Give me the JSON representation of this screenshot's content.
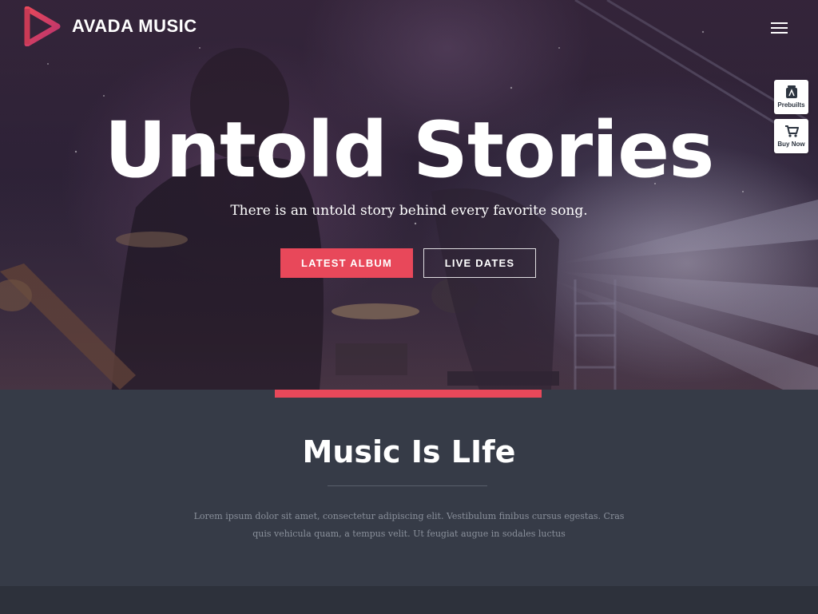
{
  "brand": {
    "name": "AVADA MUSIC",
    "accent_color": "#e8485a",
    "logo_icon": "play-triangle-icon"
  },
  "header": {
    "menu_icon": "hamburger-menu-icon"
  },
  "side_widgets": [
    {
      "label": "Prebuilts",
      "icon": "prebuilts-icon"
    },
    {
      "label": "Buy Now",
      "icon": "cart-icon"
    }
  ],
  "hero": {
    "title": "Untold Stories",
    "subtitle": "There is an untold story behind every favorite song.",
    "primary_button": "LATEST ALBUM",
    "secondary_button": "LIVE DATES"
  },
  "section": {
    "title": "Music Is LIfe",
    "body": "Lorem ipsum dolor sit amet, consectetur adipiscing elit. Vestibulum finibus cursus egestas. Cras quis vehicula quam, a tempus velit. Ut feugiat augue in sodales luctus"
  },
  "colors": {
    "section_background": "#363b47",
    "footer_background": "#2d313b",
    "body_text": "#8a909b"
  }
}
